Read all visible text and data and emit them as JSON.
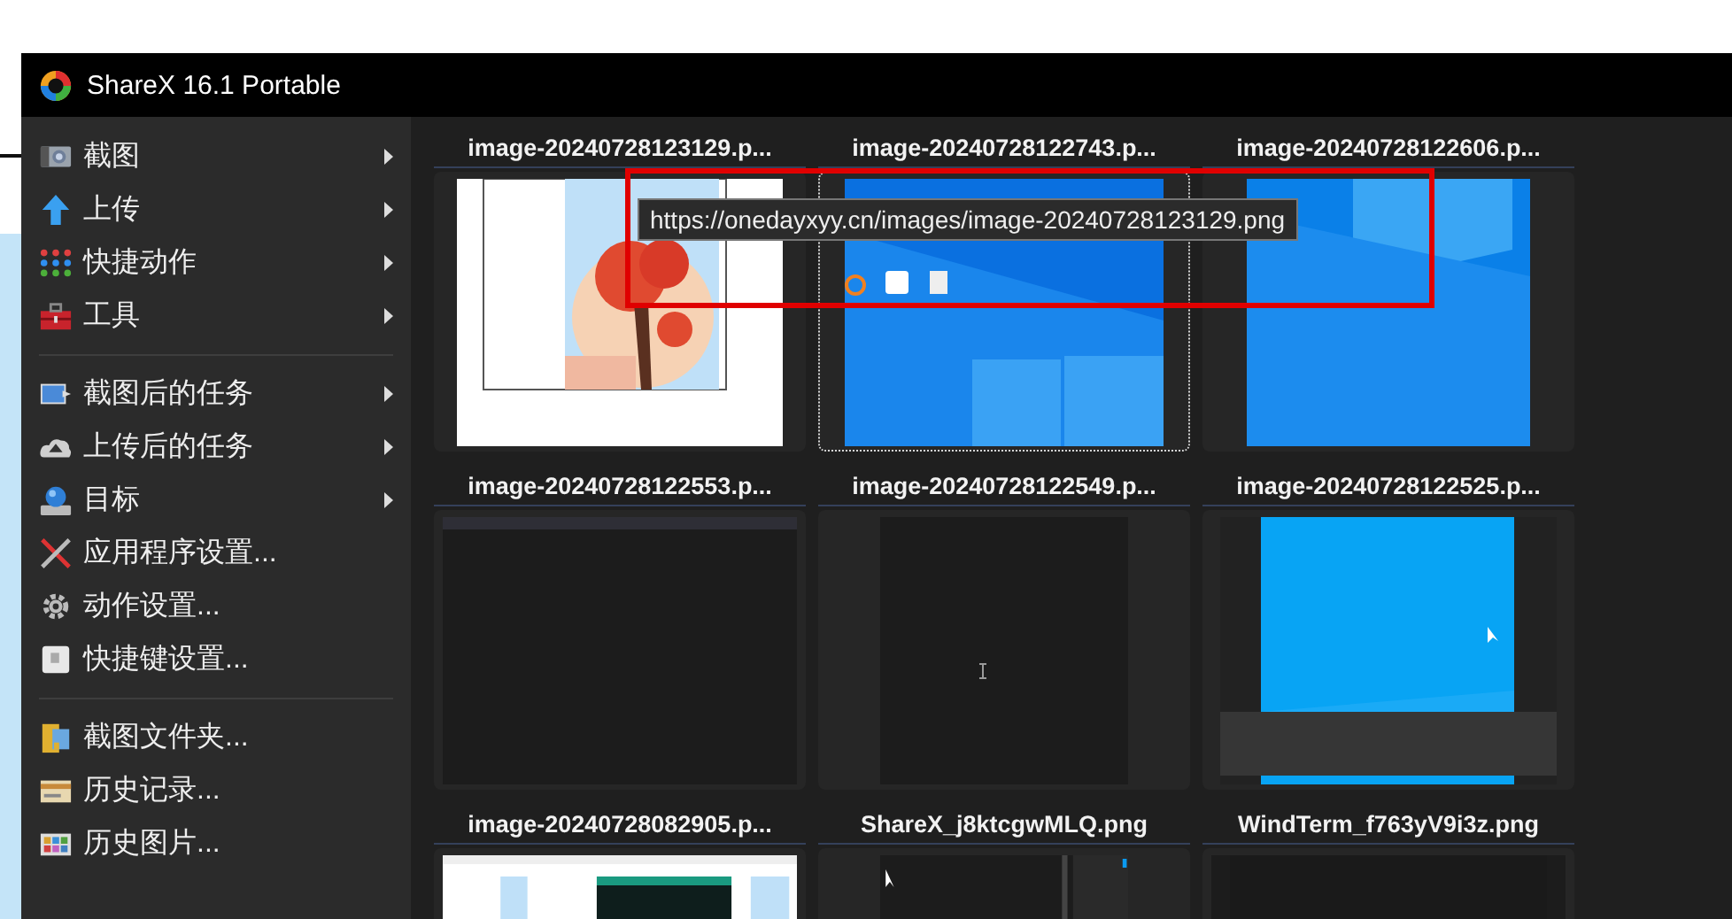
{
  "window": {
    "title": "ShareX 16.1 Portable"
  },
  "menu_groups": [
    {
      "items": [
        {
          "label": "截图",
          "submenu": true
        },
        {
          "label": "上传",
          "submenu": true
        },
        {
          "label": "快捷动作",
          "submenu": true
        },
        {
          "label": "工具",
          "submenu": true
        }
      ]
    },
    {
      "items": [
        {
          "label": "截图后的任务",
          "submenu": true
        },
        {
          "label": "上传后的任务",
          "submenu": true
        },
        {
          "label": "目标",
          "submenu": true
        },
        {
          "label": "应用程序设置...",
          "submenu": false
        },
        {
          "label": "动作设置...",
          "submenu": false
        },
        {
          "label": "快捷键设置...",
          "submenu": false
        }
      ]
    },
    {
      "items": [
        {
          "label": "截图文件夹...",
          "submenu": false
        },
        {
          "label": "历史记录...",
          "submenu": false
        },
        {
          "label": "历史图片...",
          "submenu": false
        }
      ]
    }
  ],
  "gallery": [
    {
      "name": "image-20240728123129.p...",
      "selected": false
    },
    {
      "name": "image-20240728122743.p...",
      "selected": true
    },
    {
      "name": "image-20240728122606.p...",
      "selected": false
    },
    {
      "name": "image-20240728122553.p...",
      "selected": false
    },
    {
      "name": "image-20240728122549.p...",
      "selected": false
    },
    {
      "name": "image-20240728122525.p...",
      "selected": false
    },
    {
      "name": "image-20240728082905.p...",
      "selected": false
    },
    {
      "name": "ShareX_j8ktcgwMLQ.png",
      "selected": false
    },
    {
      "name": "WindTerm_f763yV9i3z.png",
      "selected": false
    }
  ],
  "tooltip": {
    "text": "https://onedayxyy.cn/images/image-20240728123129.png"
  }
}
